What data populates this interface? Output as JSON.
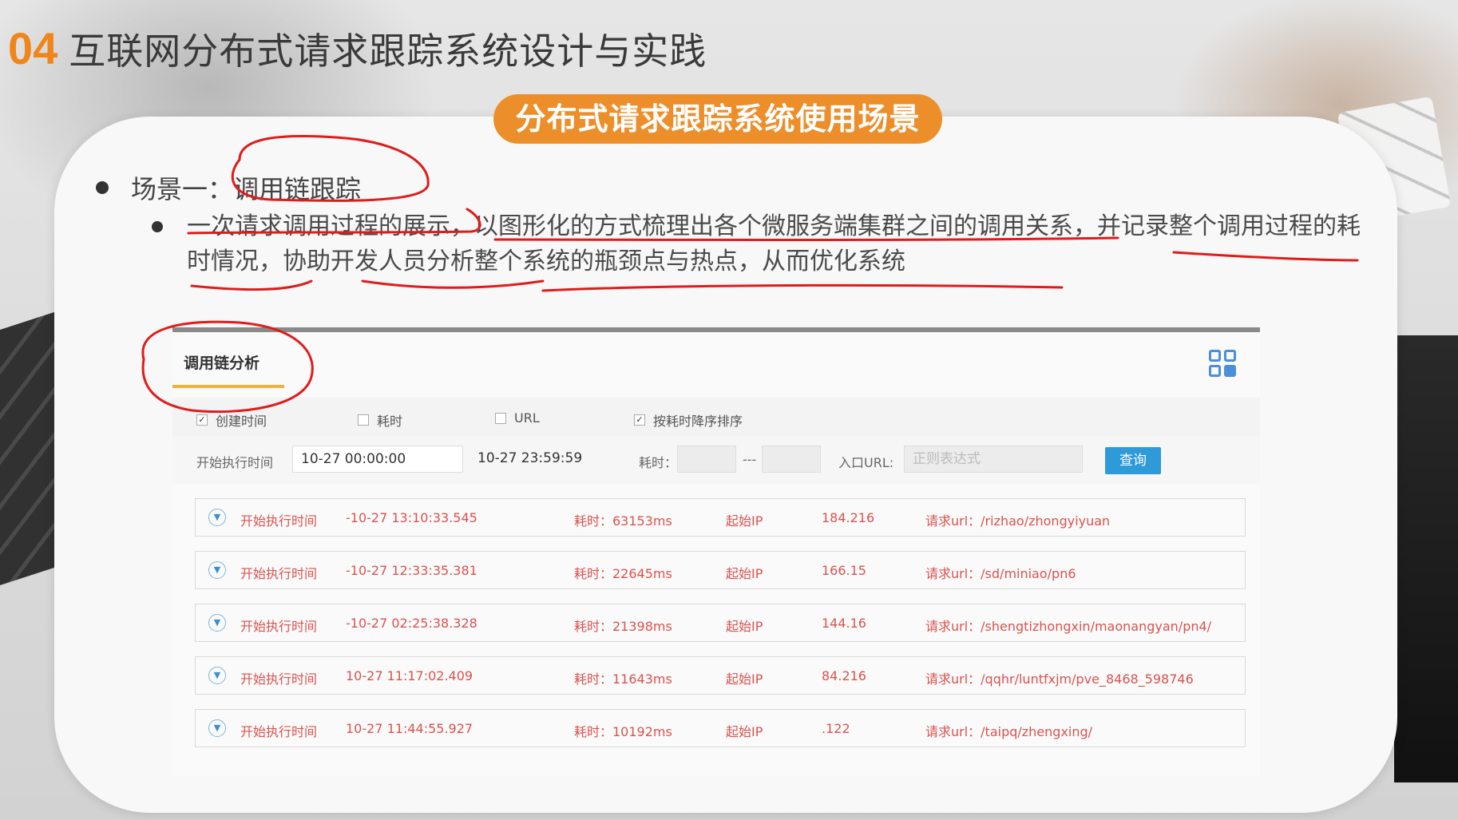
{
  "slide": {
    "number": "04",
    "title": "互联网分布式请求跟踪系统设计与实践",
    "section_pill": "分布式请求跟踪系统使用场景",
    "scenario_label": "场景一：调用链跟踪",
    "scenario_desc": "一次请求调用过程的展示，以图形化的方式梳理出各个微服务端集群之间的调用关系，并记录整个调用过程的耗时情况，协助开发人员分析整个系统的瓶颈点与热点，从而优化系统"
  },
  "panel": {
    "tab_label": "调用链分析",
    "filters": [
      {
        "label": "创建时间",
        "checked": true
      },
      {
        "label": "耗时",
        "checked": false
      },
      {
        "label": "URL",
        "checked": false
      },
      {
        "label": "按耗时降序排序",
        "checked": true
      }
    ],
    "search": {
      "start_label": "开始执行时间",
      "start_from": "10-27 00:00:00",
      "start_to": "10-27 23:59:59",
      "duration_label": "耗时：",
      "duration_sep": "---",
      "entry_url_label": "入口URL:",
      "entry_url_placeholder": "正则表达式",
      "query_button": "查询"
    },
    "rows": [
      {
        "time_label": "开始执行时间",
        "time": "-10-27 13:10:33.545",
        "duration": "耗时：63153ms",
        "ip_label": "起始IP",
        "ip": "184.216",
        "url": "请求url：/rizhao/zhongyiyuan"
      },
      {
        "time_label": "开始执行时间",
        "time": "-10-27 12:33:35.381",
        "duration": "耗时：22645ms",
        "ip_label": "起始IP",
        "ip": "166.15",
        "url": "请求url：/sd/miniao/pn6"
      },
      {
        "time_label": "开始执行时间",
        "time": "-10-27 02:25:38.328",
        "duration": "耗时：21398ms",
        "ip_label": "起始IP",
        "ip": "144.16",
        "url": "请求url：/shengtizhongxin/maonangyan/pn4/"
      },
      {
        "time_label": "开始执行时间",
        "time": "10-27 11:17:02.409",
        "duration": "耗时：11643ms",
        "ip_label": "起始IP",
        "ip": "84.216",
        "url": "请求url：/qqhr/luntfxjm/pve_8468_598746"
      },
      {
        "time_label": "开始执行时间",
        "time": "10-27 11:44:55.927",
        "duration": "耗时：10192ms",
        "ip_label": "起始IP",
        "ip": ".122",
        "url": "请求url：/taipq/zhengxing/"
      }
    ]
  },
  "colors": {
    "accent_orange": "#ec8f2b",
    "annotation_red": "#e01b1b",
    "row_text_red": "#d9534f",
    "query_blue": "#2e9ad8"
  }
}
